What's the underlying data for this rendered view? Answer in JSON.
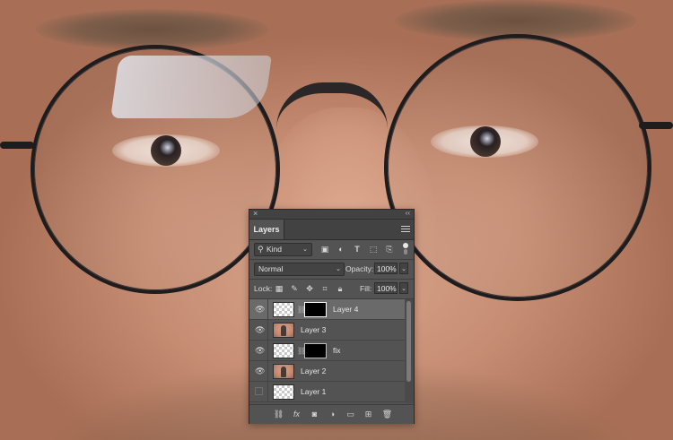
{
  "panel": {
    "tab_label": "Layers",
    "filter": {
      "kind_label": "Kind"
    },
    "blend_mode": "Normal",
    "opacity_label": "Opacity:",
    "opacity_value": "100%",
    "lock_label": "Lock:",
    "fill_label": "Fill:",
    "fill_value": "100%",
    "layers": [
      {
        "name": "Layer 4",
        "visible": true,
        "has_mask": true,
        "thumb": "transparent",
        "selected": true
      },
      {
        "name": "Layer 3",
        "visible": true,
        "has_mask": false,
        "thumb": "photo",
        "selected": false
      },
      {
        "name": "fix",
        "visible": true,
        "has_mask": true,
        "thumb": "transparent",
        "selected": false
      },
      {
        "name": "Layer 2",
        "visible": true,
        "has_mask": false,
        "thumb": "photo",
        "selected": false
      },
      {
        "name": "Layer 1",
        "visible": false,
        "has_mask": false,
        "thumb": "transparent",
        "selected": false
      }
    ],
    "filter_icons": [
      "image-filter-icon",
      "adjustment-filter-icon",
      "type-filter-icon",
      "shape-filter-icon",
      "smart-object-filter-icon"
    ],
    "lock_icons": [
      "lock-transparent-pixels-icon",
      "lock-image-pixels-icon",
      "lock-position-icon",
      "lock-artboard-icon",
      "lock-all-icon"
    ],
    "bottom_icons": [
      "link-layers-icon",
      "fx-icon",
      "add-mask-icon",
      "adjustment-layer-icon",
      "new-group-icon",
      "new-layer-icon",
      "trash-icon"
    ],
    "fx_label": "fx"
  },
  "colors": {
    "panel_bg": "#535353",
    "selected_row": "#6a6a6a"
  }
}
